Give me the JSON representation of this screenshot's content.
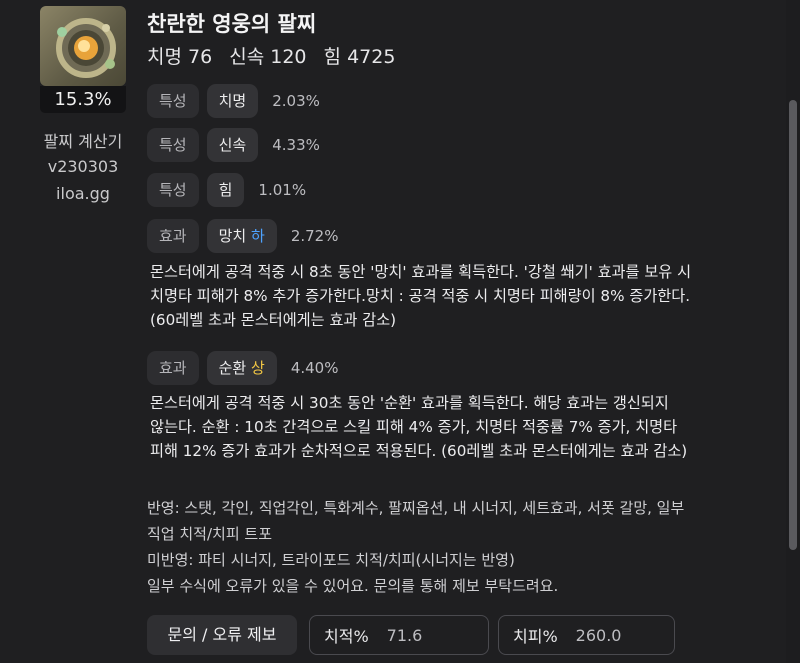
{
  "item": {
    "name": "찬란한 영웅의 팔찌",
    "percent": "15.3%",
    "stats": [
      "치명 76",
      "신속 120",
      "힘 4725"
    ]
  },
  "sidebar": {
    "line1": "팔찌 계산기",
    "line2": "v230303",
    "line3": "iloa.gg"
  },
  "rows": [
    {
      "type": "특성",
      "name": "치명",
      "value": "2.03%"
    },
    {
      "type": "특성",
      "name": "신속",
      "value": "4.33%"
    },
    {
      "type": "특성",
      "name": "힘",
      "value": "1.01%"
    },
    {
      "type": "효과",
      "name": "망치",
      "grade": "하",
      "value": "2.72%",
      "desc": "몬스터에게 공격 적중 시 8초 동안 '망치' 효과를 획득한다. '강철 쐐기' 효과를 보유 시\n치명타 피해가 8% 추가 증가한다.망치 : 공격 적중 시 치명타 피해량이 8% 증가한다.\n(60레벨 초과 몬스터에게는 효과 감소)"
    },
    {
      "type": "효과",
      "name": "순환",
      "grade": "상",
      "value": "4.40%",
      "desc": "몬스터에게 공격 적중 시 30초 동안 '순환' 효과를 획득한다. 해당 효과는 갱신되지\n않는다. 순환 : 10초 간격으로 스킬 피해 4% 증가, 치명타 적중률 7% 증가, 치명타\n피해 12% 증가 효과가 순차적으로 적용된다. (60레벨 초과 몬스터에게는 효과 감소)"
    }
  ],
  "notes": "반영: 스탯, 각인, 직업각인, 특화계수, 팔찌옵션, 내 시너지, 세트효과, 서폿 갈망, 일부\n직업 치적/치피 트포\n미반영: 파티 시너지, 트라이포드 치적/치피(시너지는 반영)\n일부 수식에 오류가 있을 수 있어요. 문의를 통해 제보 부탁드려요.",
  "footer": {
    "report_button": "문의 / 오류 제보",
    "crit_rate_label": "치적%",
    "crit_rate_value": "71.6",
    "crit_dmg_label": "치피%",
    "crit_dmg_value": "260.0"
  },
  "colors": {
    "background": "#1f1f21",
    "grade_low": "#4ea3ff",
    "grade_high": "#f2c744"
  },
  "icons": {
    "item_icon": "bracelet-item-icon"
  }
}
